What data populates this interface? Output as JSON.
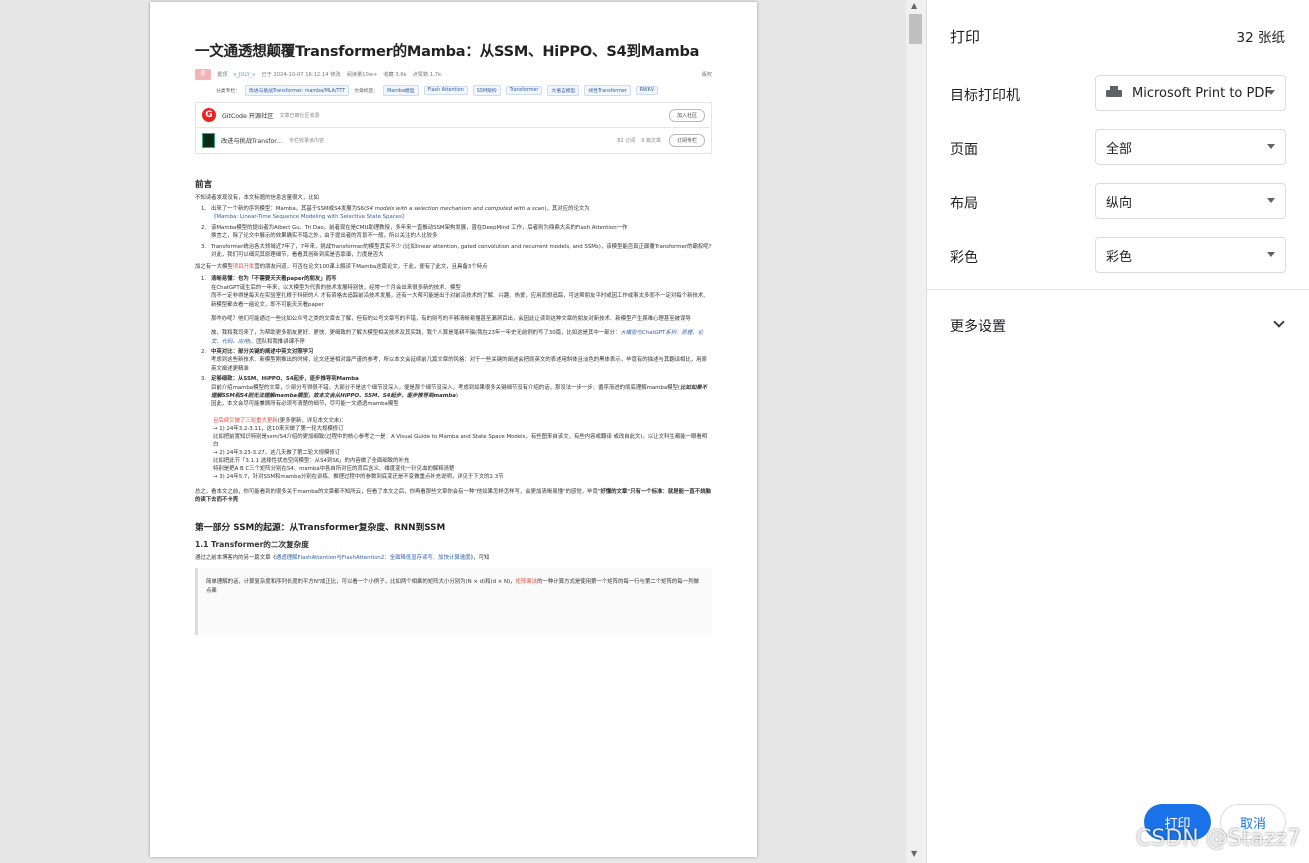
{
  "article": {
    "title": "一文通透想颠覆Transformer的Mamba：从SSM、HiPPO、S4到Mamba",
    "avatar_text": "原",
    "author": "v_JULY_v",
    "author_prefix": "置顶",
    "date": "已于 2024-10-07 16:12:14 修改",
    "reads": "阅读量10w+",
    "favs": "收藏 3.6k",
    "likes": "点赞数 1.7k",
    "copyright": "版权",
    "column_label": "分类专栏：",
    "column_tag": "改进与挑战Transformer: mamba/MLA/TTT",
    "tags_label": "文章标签：",
    "tags": [
      "Mamba模型",
      "Flash Attention",
      "SSM架构",
      "Transformer",
      "大语言模型",
      "线性Transformer",
      "RWKV"
    ],
    "card1_title": "GitCode 开源社区",
    "card1_sub": "文章已被社区收录",
    "card1_btn": "加入社区",
    "card2_title": "改进与挑战Transfor…",
    "card2_sub": "专栏收录该内容",
    "card2_subs": "82 订阅",
    "card2_count": "9 篇文章",
    "card2_btn": "订阅专栏",
    "preface_h": "前言",
    "preface_p": "不知读者发现没有，本文标题的信息含量很大，比如",
    "list1": [
      {
        "a": "出来了一个新的序列模型：Mamba，其基于SSM或S4发展为S6(",
        "b": "S4 models with a selection mechanism and computed with a scan",
        "c": ")，其对应的论文为",
        "d": "《Mamba: Linear-Time Sequence Modeling with Selective State Spaces》"
      },
      {
        "a": "该Mamba模型的提出者为Albert Gu、Tri Dao，前者现在是CMU助理教授，多年来一直推动SSM架构发展，曾在DeepMind 工作，后者则为鼎鼎大名的Flash Attention一作",
        "b": "换言之，除了论文中展示的效果确实不错之外，由于提出者的背景不一般，所以关注的人比较多"
      },
      {
        "a": "Transformer统治各大领域近7年了，7年来，挑战Transformer的模型其实不少 (比如linear attention, gated convolution and recurrent models, and SSMs)，该模型能否真正颠覆Transformer的霸权呢?",
        "b": "对此，我们可以细究其原理细节，看看其创新到底是否靠谱，力度是否大"
      }
    ],
    "p2a": "加之有一大模型",
    "p2b": "项目开发",
    "p2c": "营的朋友问道，可否在论文100课上解读下Mamba这篇论文，于此，便有了此文，且具备3个特点",
    "list2": [
      {
        "h": "清晰易懂：也为「不需要天天看paper的朋友」而写",
        "a": "在ChatGPT诞生后的一年来，以大模型为代表的技术发展特别快，经常一个月会出来很多新的技术、模型",
        "b": "而不一定非得是每天在实验室扎根于科研的人 才有资格去追踪前沿技术发展，还有一大帮可能是出于对前沿技术的了解、兴趣、热爱，应用而想追踪，可这帮朋友平时或因工作或事太多而不一定对每个新技术、新模型都去看一遍论文，即不可能天天看paper",
        "c": "那咋办呢？他们可能通过一些比如公众号之类的文章去了解，但有的公号文章写的不错，有的则写的不够清晰易懂甚至漏洞百出，会因此让读到这种文章的朋友对新技术、新模型产生畏难心理甚至被误导",
        "d": "故，我和我司来了，为帮助更多朋友更好、更快、更细致的了解大模型相关技术及其实践，我个人算是笔耕不辍(我在23年一年史无前例的写了30篇，比如这是其中一部分：",
        "e": "大模型与ChatGPT系列：原理、论文、代码、应用",
        "f": ")、团队和我推讲课不停"
      },
      {
        "h": "中英对比：部分关键的阐述中英文对照学习",
        "a": "考虑到这些新技术、新模型刚推出的时候，论文还是相对最严谨的参考，所以本文会延续前几篇文章的风格：对于一些关键的阐述会把原英文的表述用斜体且淡色的黑体表示，毕竟有的描述与其翻译相比，用原英文阐述更精准"
      },
      {
        "h": "足够细致：从SSM、HiPPO、S4起步，逐步推导到Mamba",
        "a": "目前介绍mamba模型的文章，少部分写得很不错，大部分不是这个细节没深入，便是那个细节没深入，考虑到如果很多关键细节没有介绍的话，那没法一步一步、循序渐进的彻底理解mamba模型(",
        "b": "比如如果不理解SSM和S4则无法理解mamba模型，故本文会从HiPPO、SSM、S4起步，逐步推导到mamba",
        "c": ")",
        "d": "因此，本文会尽可能兼顾所有必须写清楚的细节，尽可能一文通透mamba模型"
      }
    ],
    "upd_red": "且后续又做了三轮重大更新",
    "upd_black": "(更多更新，详见本文文末)：",
    "upd": [
      "→ 1) 24年3.2-3.11，这10来天做了第一轮大规模修订",
      "比如把前置知识特别是ssm/S4介绍的更加细致(过程中的核心参考之一是：A Visual Guide to Mamba and State Space Models，有些图来自该文，有些内容或翻译 或改自此文)，以让文科生都能一眼看明白",
      "→ 2) 24年3.23-3.27，这几天做了第二轮大规模修订",
      "比如把此节「3.1.1 选择性状态空间模型：从S4到S6」的内容做了全面细致的补充",
      "特别是把A B C三个矩阵分别在S4、mamba中各自所对应的背后含义、维度变化一针见血的解释清楚",
      "→ 3) 24年5.7，针对SSM和mamba分别在训练、推理过程中的参数到底变还是不变做重点补充说明，详见于下文的2.3节"
    ],
    "summary_a": "总之，看本文之前，你可能看到的很多关于mamba的文章都不知所云，但看了本文之后，你再看那些文章你会有一种\"他如果怎样怎样写，会更加清晰易懂\"的感觉，毕竟\"",
    "summary_b": "好懂的文章\"只有一个标准：就是能一直不烧脑的读下去而不卡壳",
    "part1_h": "第一部分 SSM的起源：从Transformer复杂度、RNN到SSM",
    "sec11_h": "1.1 Transformer的二次复杂度",
    "sec11_pa": "通过之前本博客内的另一篇文章《",
    "sec11_link": "通透理解FlashAttention与FlashAttention2：全面降低显存读写、加快计算速度",
    "sec11_pb": "》，可知",
    "quote_a": "简单理解的话，计算复杂度和序列长度的平方N²成正比，可以看一个小例子，比如两个相乘的矩阵大小分别为(N × d)和(d × N)，",
    "quote_red": "矩阵乘法",
    "quote_b": "的一种计算方式是使用第一个矩阵的每一行与第二个矩阵的每一列做点乘"
  },
  "panel": {
    "title": "打印",
    "sheets": "32 张纸",
    "dest_label": "目标打印机",
    "dest_value": "Microsoft Print to PDF",
    "pages_label": "页面",
    "pages_value": "全部",
    "layout_label": "布局",
    "layout_value": "纵向",
    "color_label": "彩色",
    "color_value": "彩色",
    "more": "更多设置",
    "print_btn": "打印",
    "cancel_btn": "取消"
  },
  "watermark": "CSDN @Stazz7",
  "colors": {
    "accent": "#1a73e8",
    "link": "#2f5fa7",
    "highlight": "#e74c3c"
  },
  "icons": [
    "printer-icon",
    "chevron-down-icon",
    "gitcode-logo-icon"
  ]
}
